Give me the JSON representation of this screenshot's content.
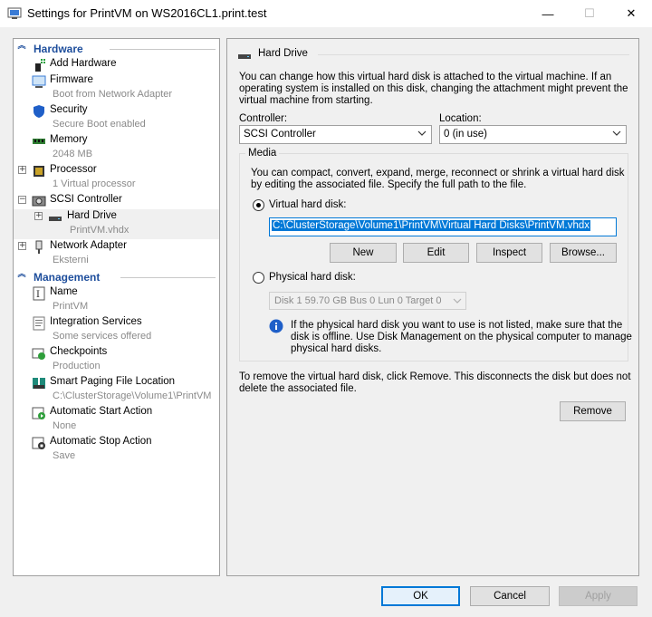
{
  "window": {
    "title": "Settings for PrintVM on WS2016CL1.print.test",
    "minimize_glyph": "—",
    "maximize_glyph": "☐",
    "close_glyph": "✕"
  },
  "sidebar": {
    "hardware_header": "Hardware",
    "management_header": "Management",
    "hardware_items": [
      {
        "label": "Add Hardware",
        "sub": "",
        "icon": "add-hardware-icon"
      },
      {
        "label": "Firmware",
        "sub": "Boot from Network Adapter",
        "icon": "firmware-icon"
      },
      {
        "label": "Security",
        "sub": "Secure Boot enabled",
        "icon": "security-shield-icon"
      },
      {
        "label": "Memory",
        "sub": "2048 MB",
        "icon": "memory-icon"
      },
      {
        "label": "Processor",
        "sub": "1 Virtual processor",
        "icon": "processor-icon"
      },
      {
        "label": "SCSI Controller",
        "sub": "",
        "icon": "scsi-controller-icon"
      },
      {
        "label": "Hard Drive",
        "sub": "PrintVM.vhdx",
        "icon": "hard-drive-icon"
      },
      {
        "label": "Network Adapter",
        "sub": "Eksterni",
        "icon": "network-adapter-icon"
      }
    ],
    "management_items": [
      {
        "label": "Name",
        "sub": "PrintVM",
        "icon": "name-icon"
      },
      {
        "label": "Integration Services",
        "sub": "Some services offered",
        "icon": "integration-services-icon"
      },
      {
        "label": "Checkpoints",
        "sub": "Production",
        "icon": "checkpoints-icon"
      },
      {
        "label": "Smart Paging File Location",
        "sub": "C:\\ClusterStorage\\Volume1\\PrintVM",
        "icon": "smart-paging-icon"
      },
      {
        "label": "Automatic Start Action",
        "sub": "None",
        "icon": "auto-start-icon"
      },
      {
        "label": "Automatic Stop Action",
        "sub": "Save",
        "icon": "auto-stop-icon"
      }
    ]
  },
  "panel": {
    "title": "Hard Drive",
    "intro": [
      "You can change how this virtual hard disk is attached to the virtual machine. If an",
      "operating system is installed on this disk, changing the attachment might prevent the",
      "virtual machine from starting."
    ],
    "controller_label": "Controller:",
    "controller_value": "SCSI Controller",
    "location_label": "Location:",
    "location_value": "0 (in use)",
    "media_legend": "Media",
    "media_desc": [
      "You can compact, convert, expand, merge, reconnect or shrink a virtual hard disk",
      "by editing the associated file. Specify the full path to the file."
    ],
    "vhd_label": "Virtual hard disk:",
    "vhd_path": "C:\\ClusterStorage\\Volume1\\PrintVM\\Virtual Hard Disks\\PrintVM.vhdx",
    "buttons": {
      "new": "New",
      "edit": "Edit",
      "inspect": "Inspect",
      "browse": "Browse..."
    },
    "physical_label": "Physical hard disk:",
    "physical_value": "Disk 1 59.70 GB Bus 0 Lun 0 Target 0",
    "info": [
      "If the physical hard disk you want to use is not listed, make sure that the",
      "disk is offline. Use Disk Management on the physical computer to manage",
      "physical hard disks."
    ],
    "remove_desc": [
      "To remove the virtual hard disk, click Remove. This disconnects the disk but does not",
      "delete the associated file."
    ],
    "remove_button": "Remove"
  },
  "footer": {
    "ok": "OK",
    "cancel": "Cancel",
    "apply": "Apply"
  }
}
